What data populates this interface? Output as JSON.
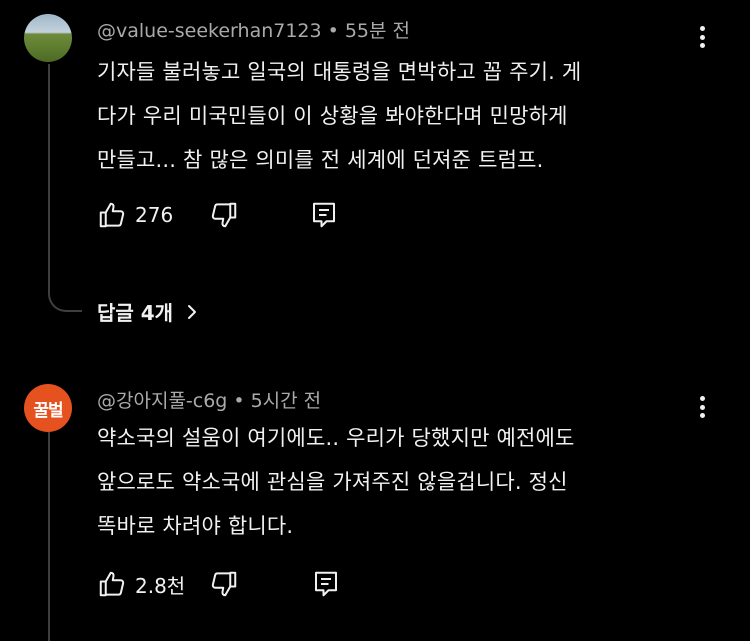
{
  "comments": [
    {
      "author": "@value-seekerhan7123",
      "time": "55분 전",
      "lines": [
        "기자들 불러놓고 일국의 대통령을 면박하고 꼽 주기. 게",
        "다가 우리 미국민들이 이 상황을 봐야한다며 민망하게",
        "만들고... 참 많은 의미를 전 세계에 던져준 트럼프."
      ],
      "likes": "276",
      "replies_label": "답글 4개",
      "avatar_icon": "landscape-photo-avatar"
    },
    {
      "author": "@강아지풀-c6g",
      "time": "5시간 전",
      "lines": [
        "약소국의 설움이 여기에도.. 우리가 당했지만 예전에도",
        "앞으로도 약소국에 관심을 가져주진 않을겁니다. 정신",
        "똑바로 차려야 합니다."
      ],
      "likes": "2.8천",
      "avatar_text": "꿀벌",
      "avatar_color": "#e6521f"
    }
  ],
  "separator": "•",
  "colors": {
    "background": "#000000",
    "text": "#f1f1f1",
    "meta": "#aaaaaa",
    "thread_line": "#3f3f3f"
  }
}
